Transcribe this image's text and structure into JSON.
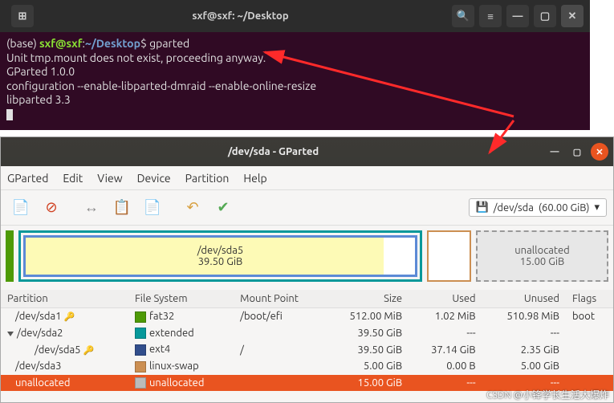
{
  "terminal": {
    "title": "sxf@sxf: ~/Desktop",
    "prompt_base": "(base) ",
    "prompt_user": "sxf@sxf",
    "prompt_colon": ":",
    "prompt_path": "~/Desktop",
    "prompt_dollar": "$ ",
    "command": "gparted",
    "line1": "Unit tmp.mount does not exist, proceeding anyway.",
    "line2": "GParted 1.0.0",
    "line3": "configuration --enable-libparted-dmraid --enable-online-resize",
    "line4": "libparted 3.3"
  },
  "gparted": {
    "title": "/dev/sda - GParted",
    "menu": {
      "m0": "GParted",
      "m1": "Edit",
      "m2": "View",
      "m3": "Device",
      "m4": "Partition",
      "m5": "Help"
    },
    "device_selector": {
      "icon": "💾",
      "name": "/dev/sda",
      "size": "(60.00 GiB)",
      "caret": "▾"
    },
    "map": {
      "sda5_name": "/dev/sda5",
      "sda5_size": "39.50 GiB",
      "unalloc_name": "unallocated",
      "unalloc_size": "15.00 GiB"
    },
    "headers": {
      "partition": "Partition",
      "fs": "File System",
      "mount": "Mount Point",
      "size": "Size",
      "used": "Used",
      "unused": "Unused",
      "flags": "Flags"
    },
    "rows": {
      "r0": {
        "name": "/dev/sda1",
        "fs": "fat32",
        "mount": "/boot/efi",
        "size": "512.00 MiB",
        "used": "1.02 MiB",
        "unused": "510.98 MiB",
        "flags": "boot"
      },
      "r1": {
        "name": "/dev/sda2",
        "fs": "extended",
        "mount": "",
        "size": "39.50 GiB",
        "used": "---",
        "unused": "---",
        "flags": ""
      },
      "r2": {
        "name": "/dev/sda5",
        "fs": "ext4",
        "mount": "/",
        "size": "39.50 GiB",
        "used": "37.14 GiB",
        "unused": "2.35 GiB",
        "flags": ""
      },
      "r3": {
        "name": "/dev/sda3",
        "fs": "linux-swap",
        "mount": "",
        "size": "5.00 GiB",
        "used": "0.00 B",
        "unused": "5.00 GiB",
        "flags": ""
      },
      "r4": {
        "name": "unallocated",
        "fs": "unallocated",
        "mount": "",
        "size": "15.00 GiB",
        "used": "---",
        "unused": "---",
        "flags": ""
      }
    }
  },
  "watermark": "CSDN @小锋学长生活大爆炸"
}
